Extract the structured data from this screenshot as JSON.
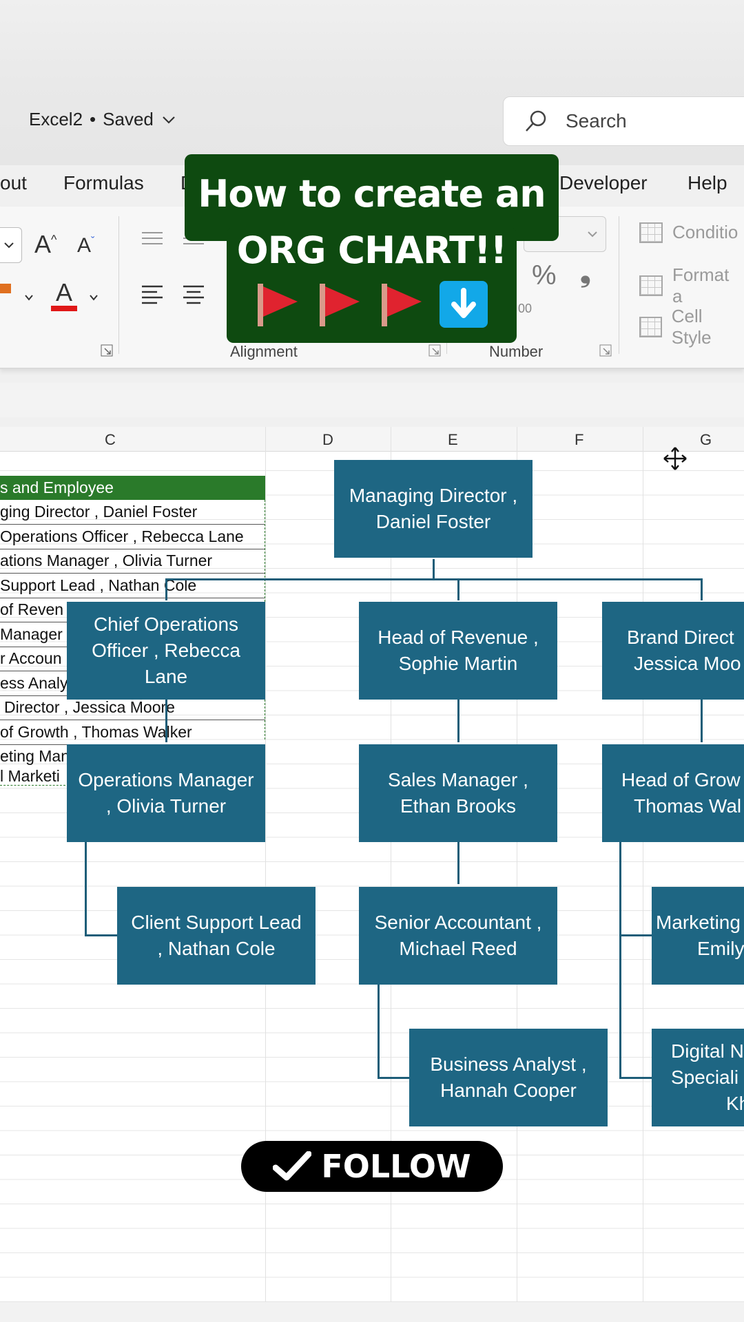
{
  "window": {
    "doc_name": "Excel2",
    "separator": "•",
    "save_status": "Saved",
    "search_placeholder": "Search"
  },
  "tabs": [
    "out",
    "Formulas",
    "D",
    "Developer",
    "Help"
  ],
  "ribbon": {
    "alignment_label": "Alignment",
    "number_label": "Number",
    "percent_symbol": "%",
    "comma_symbol": "❟",
    "decimal_glyph": "00",
    "styles": [
      "Conditio",
      "Format a",
      "Cell Style"
    ]
  },
  "banner": {
    "line1": "How to create an",
    "line2": "ORG CHART!!",
    "flag_count": 3,
    "colors": {
      "banner_bg": "#0e4a10",
      "flag": "#e0232f",
      "arrow_bg": "#12a8e8"
    }
  },
  "columns": [
    "C",
    "D",
    "E",
    "F",
    "G"
  ],
  "table": {
    "header": "s and Employee",
    "rows": [
      "ging Director , Daniel Foster",
      "Operations Officer , Rebecca Lane",
      "ations Manager , Olivia Turner",
      "Support Lead , Nathan Cole",
      "of Reven",
      "Manager",
      "r Accoun",
      "ess Analy",
      "Director , Jessica Moore",
      "of Growth , Thomas Walker",
      "eting Man",
      "l Marketi"
    ]
  },
  "org_chart": {
    "box_color": "#1e6683",
    "boxes": [
      {
        "id": "md",
        "lines": [
          "Managing Director ,",
          "Daniel Foster"
        ]
      },
      {
        "id": "coo",
        "lines": [
          "Chief Operations",
          "Officer , Rebecca",
          "Lane"
        ]
      },
      {
        "id": "hor",
        "lines": [
          "Head of Revenue ,",
          "Sophie Martin"
        ]
      },
      {
        "id": "bd",
        "lines": [
          "Brand Direct",
          "Jessica Moo"
        ]
      },
      {
        "id": "om",
        "lines": [
          "Operations Manager",
          ", Olivia Turner"
        ]
      },
      {
        "id": "sm",
        "lines": [
          "Sales Manager ,",
          "Ethan Brooks"
        ]
      },
      {
        "id": "hog",
        "lines": [
          "Head of Grow",
          "Thomas Wal"
        ]
      },
      {
        "id": "csl",
        "lines": [
          "Client Support Lead",
          ", Nathan Cole"
        ]
      },
      {
        "id": "sa",
        "lines": [
          "Senior Accountant ,",
          "Michael Reed"
        ]
      },
      {
        "id": "mk",
        "lines": [
          "Marketing",
          "Emily"
        ]
      },
      {
        "id": "ba",
        "lines": [
          "Business Analyst ,",
          "Hannah Cooper"
        ]
      },
      {
        "id": "dm",
        "lines": [
          "Digital N",
          "Speciali",
          "Kh"
        ]
      }
    ]
  },
  "follow_label": "FOLLOW"
}
